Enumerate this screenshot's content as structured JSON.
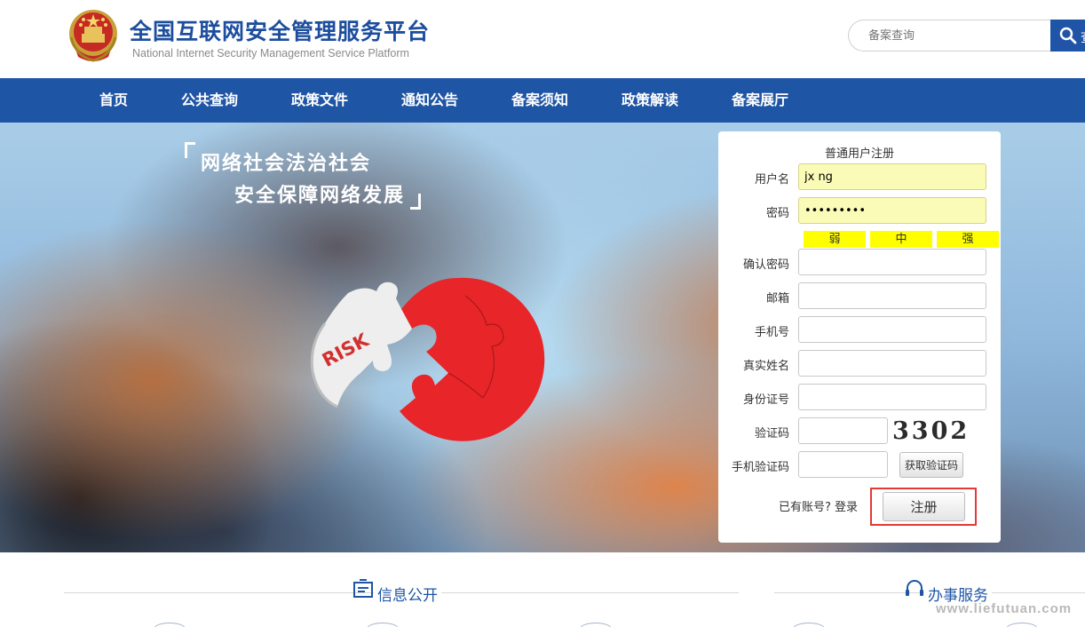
{
  "header": {
    "title": "全国互联网安全管理服务平台",
    "subtitle": "National Internet Security Management Service Platform",
    "search_placeholder": "备案查询",
    "search_button": "查"
  },
  "nav": {
    "items": [
      "首页",
      "公共查询",
      "政策文件",
      "通知公告",
      "备案须知",
      "政策解读",
      "备案展厅"
    ]
  },
  "banner": {
    "slogan_line1": "网络社会法治社会",
    "slogan_line2": "安全保障网络发展",
    "puzzle_text": "RISK"
  },
  "register": {
    "title": "普通用户注册",
    "labels": {
      "username": "用户名",
      "password": "密码",
      "confirm_password": "确认密码",
      "email": "邮箱",
      "phone": "手机号",
      "real_name": "真实姓名",
      "id_number": "身份证号",
      "captcha": "验证码",
      "sms_code": "手机验证码"
    },
    "username_value": "jx ng",
    "password_value": "•••••••••",
    "strength": [
      "弱",
      "中",
      "强"
    ],
    "captcha_image_text": "3302",
    "sms_button": "获取验证码",
    "have_account": "已有账号? 登录",
    "register_button": "注册"
  },
  "sections": {
    "info": "信息公开",
    "service": "办事服务"
  },
  "watermark": "www.liefutuan.com",
  "colors": {
    "brand_blue": "#1f55a5",
    "highlight_red": "#e53935",
    "strength_yellow": "#ffff00",
    "autofill_yellow": "#fbfbb8"
  }
}
